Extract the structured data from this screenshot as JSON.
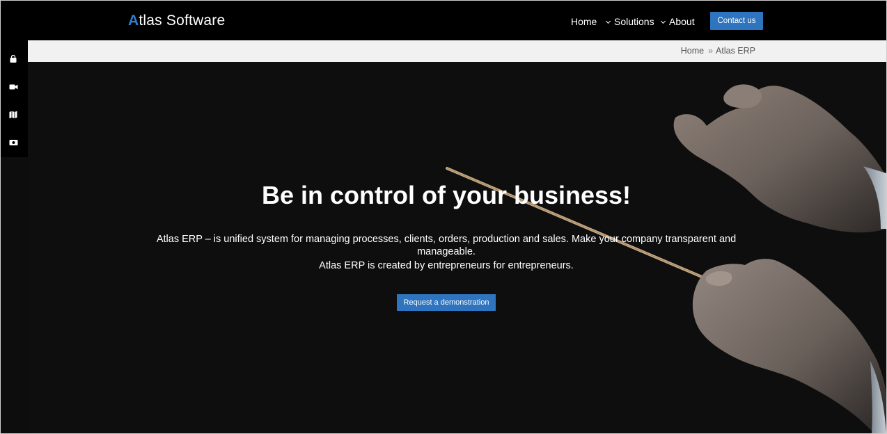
{
  "header": {
    "logo_initial": "A",
    "logo_rest": "tlas Software",
    "nav": {
      "home": "Home",
      "solutions": "Solutions",
      "about": "About"
    },
    "contact_label": "Contact us"
  },
  "breadcrumb": {
    "home": "Home",
    "separator": "»",
    "current": "Atlas ERP"
  },
  "sidebar": {
    "icons": [
      "shopping-bag-icon",
      "video-camera-icon",
      "map-icon",
      "money-bill-icon"
    ]
  },
  "hero": {
    "title": "Be in control of your business!",
    "text": "Atlas ERP – is unified system for managing processes, clients, orders, production and sales. Make your company transparent and manageable.",
    "text2": "Atlas ERP is created by entrepreneurs for entrepreneurs.",
    "cta_label": "Request a demonstration"
  },
  "colors": {
    "accent": "#2f74bf",
    "header_bg": "#000000",
    "hero_bg": "#0e0e0e",
    "crumb_bg": "#f1f1f1"
  }
}
